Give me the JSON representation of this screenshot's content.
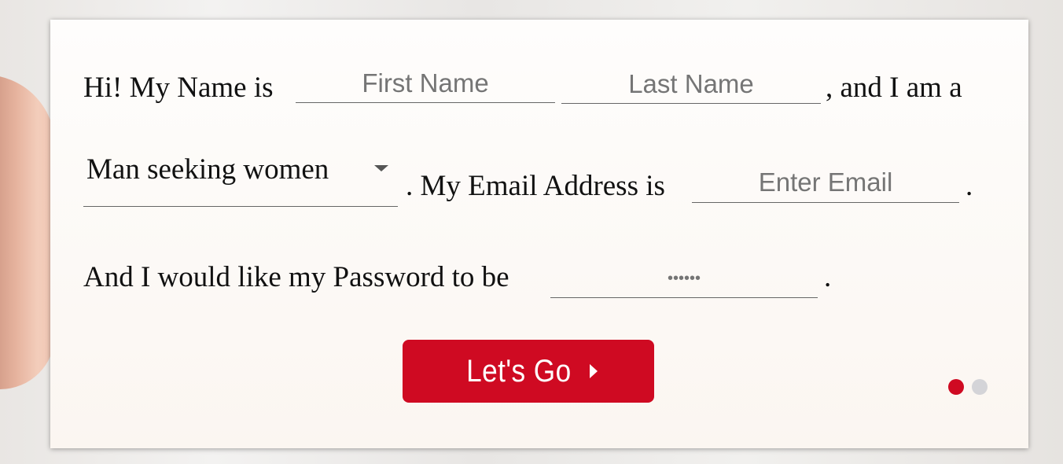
{
  "form": {
    "line1": {
      "prefix": "Hi! My Name is",
      "first_name_placeholder": "First Name",
      "last_name_placeholder": "Last Name",
      "suffix": ", and I am a"
    },
    "line2": {
      "seeking_selected": "Man seeking women",
      "email_prefix": ". My Email Address is",
      "email_placeholder": "Enter Email",
      "suffix": "."
    },
    "line3": {
      "prefix": "And I would like my Password to be",
      "password_placeholder": "••••••",
      "suffix": "."
    },
    "submit_label": "Let's Go"
  },
  "pagination": {
    "total": 2,
    "active": 1
  },
  "colors": {
    "accent": "#cf0a22",
    "dot_active": "#cf0a22",
    "dot_inactive": "#d4d4d8"
  },
  "icons": {
    "dropdown": "caret-down",
    "button_arrow": "triangle-right"
  }
}
